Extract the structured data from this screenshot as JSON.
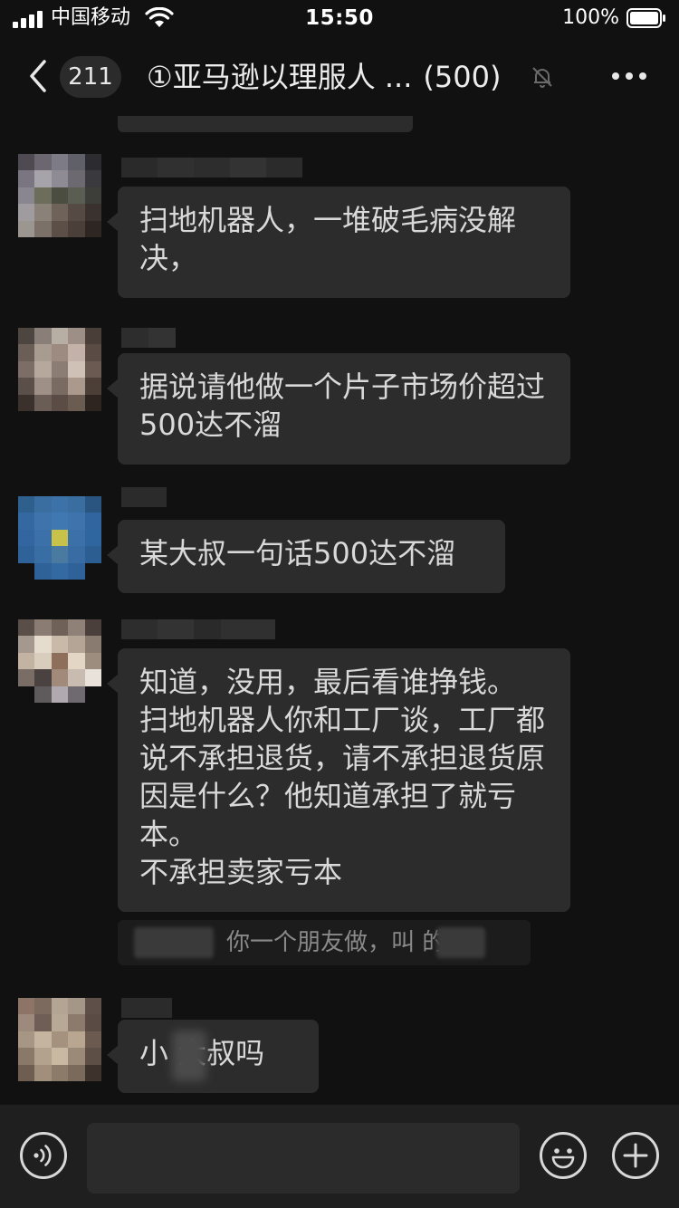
{
  "status_bar": {
    "carrier": "中国移动",
    "time": "15:50",
    "battery_percent": "100%",
    "icons": [
      "signal-bars-icon",
      "wifi-icon",
      "battery-icon"
    ]
  },
  "nav": {
    "back_icon": "chevron-left-icon",
    "unread_count": "211",
    "title": "①亚马逊以理服人 ...",
    "member_count": "(500)",
    "mute_icon": "bell-slash-icon",
    "more_icon": "more-dots-icon"
  },
  "messages": [
    {
      "text": "扫地机器人，一堆破毛病没解决，",
      "sender_blurred": true
    },
    {
      "text": "据说请他做一个片子市场价超过500达不溜",
      "sender_blurred": true
    },
    {
      "text": "某大叔一句话500达不溜",
      "sender_blurred": true
    },
    {
      "text": "知道，没用，最后看谁挣钱。\n扫地机器人你和工厂谈，工厂都说不承担退货，请不承担退货原因是什么？他知道承担了就亏本。\n不承担卖家亏本",
      "sender_blurred": true
    },
    {
      "text": "小 大叔吗",
      "sender_blurred": true
    }
  ],
  "quote": {
    "text": "你一个朋友做，叫    的"
  },
  "input_bar": {
    "voice_icon": "voice-icon",
    "input_value": "",
    "emoji_icon": "emoji-icon",
    "add_icon": "add-icon"
  },
  "colors": {
    "background": "#111111",
    "bubble": "#2c2c2c",
    "input_bar": "#1f1f1f",
    "text": "#d9d9d9"
  }
}
